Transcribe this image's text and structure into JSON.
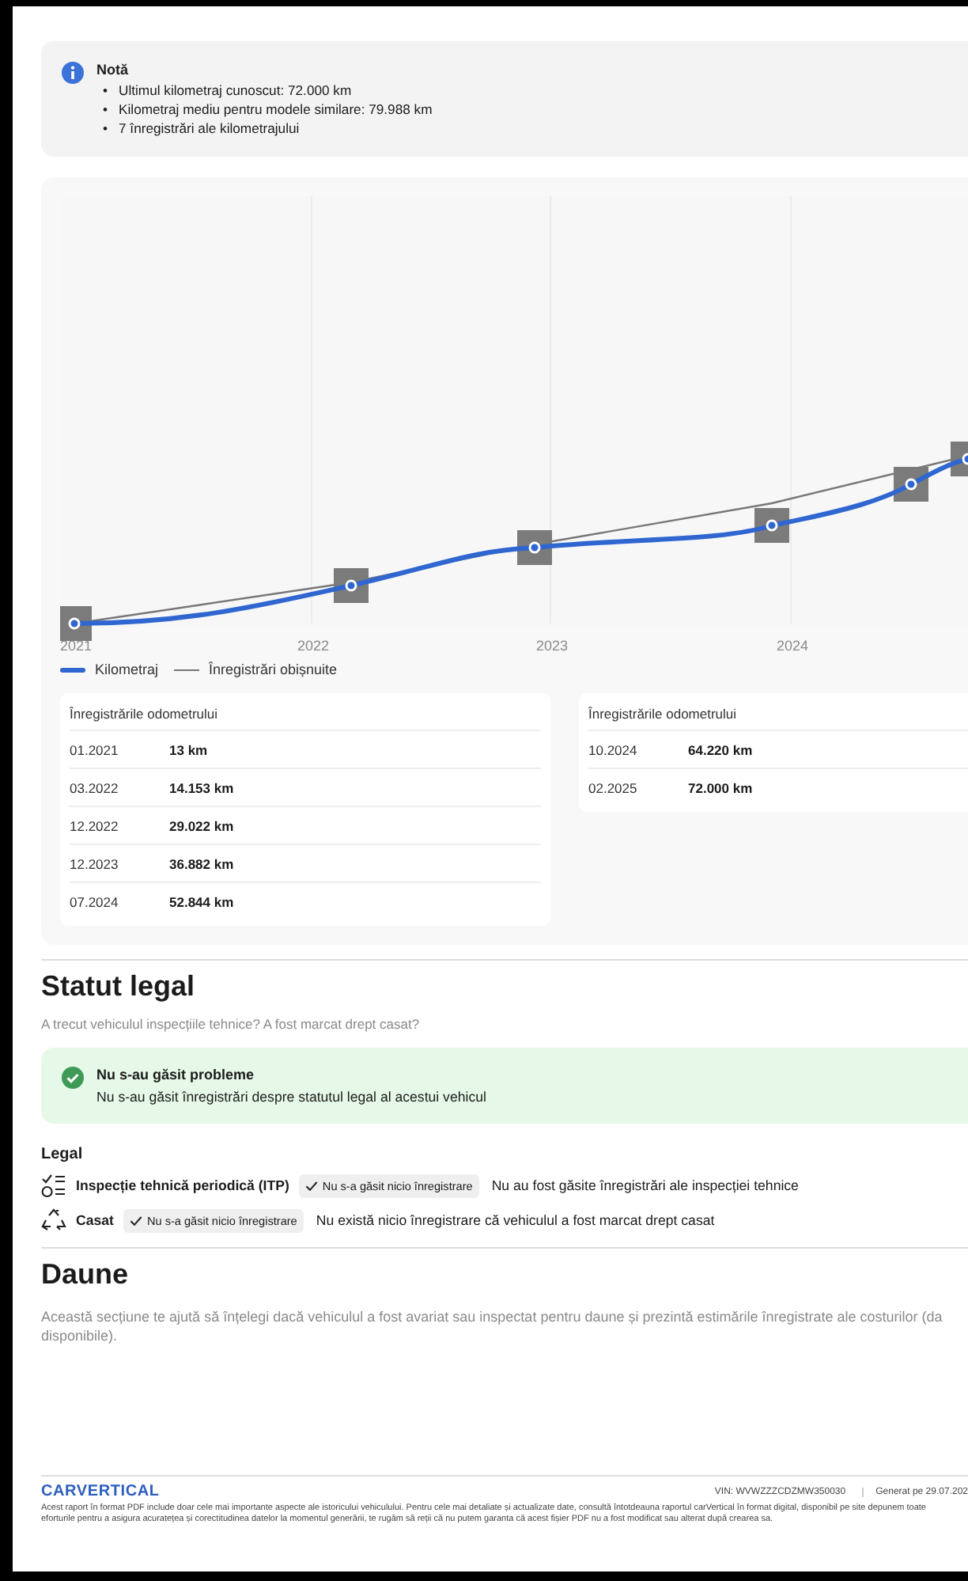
{
  "note": {
    "title": "Notă",
    "items": [
      {
        "marker": "•",
        "text": "Ultimul kilometraj cunoscut: 72.000 km"
      },
      {
        "marker": "•",
        "text": "Kilometraj mediu pentru modele similare: 79.988 km"
      },
      {
        "marker": "•",
        "text": "7 înregistrări ale kilometrajului"
      }
    ]
  },
  "chart": {
    "x_labels": [
      "2021",
      "2022",
      "2023",
      "2024"
    ],
    "legend": [
      {
        "kind": "mileage",
        "label": "Kilometraj"
      },
      {
        "kind": "typical",
        "label": "Înregistrări obișnuite"
      }
    ]
  },
  "odometer_tables": [
    {
      "title": "Înregistrările odometrului",
      "rows": [
        {
          "date": "01.2021",
          "km": "13 km"
        },
        {
          "date": "03.2022",
          "km": "14.153 km"
        },
        {
          "date": "12.2022",
          "km": "29.022 km"
        },
        {
          "date": "12.2023",
          "km": "36.882 km"
        },
        {
          "date": "07.2024",
          "km": "52.844 km"
        }
      ]
    },
    {
      "title": "Înregistrările odometrului",
      "rows": [
        {
          "date": "10.2024",
          "km": "64.220 km"
        },
        {
          "date": "02.2025",
          "km": "72.000 km"
        }
      ]
    }
  ],
  "legal_status": {
    "heading": "Statut legal",
    "subtitle": "A trecut vehiculul inspecțiile tehnice? A fost marcat drept casat?",
    "alert": {
      "title": "Nu s-au găsit probleme",
      "text": "Nu s-au găsit înregistrări despre statutul legal al acestui vehicul"
    },
    "group_title": "Legal",
    "items": [
      {
        "kind": "inspection",
        "title": "Inspecție tehnică periodică (ITP)",
        "badge": "Nu s-a găsit nicio înregistrare",
        "text": "Nu au fost găsite înregistrări ale inspecției tehnice"
      },
      {
        "kind": "scrapped",
        "title": "Casat",
        "badge": "Nu s-a găsit nicio înregistrare",
        "text": "Nu există nicio înregistrare că vehiculul a fost marcat drept casat"
      }
    ]
  },
  "damage": {
    "heading": "Daune",
    "text": "Această secțiune te ajută să înțelegi dacă vehiculul a fost avariat sau inspectat pentru daune și prezintă estimările înregistrate ale costurilor (da disponibile)."
  },
  "footer": {
    "logo": "CARVERTICAL",
    "vin": "VIN: WVWZZZCDZMW350030",
    "generated": "Generat pe 29.07.202",
    "disclaimer": "Acest raport în format PDF include doar cele mai importante aspecte ale istoricului vehiculului. Pentru cele mai detaliate și actualizate date, consultă întotdeauna raportul carVertical în format digital, disponibil pe site depunem toate eforturile pentru a asigura acuratețea și corectitudinea datelor la momentul generării, te rugăm să reții că nu putem garanta că acest fișier PDF nu a fost modificat sau alterat după crearea sa."
  }
}
